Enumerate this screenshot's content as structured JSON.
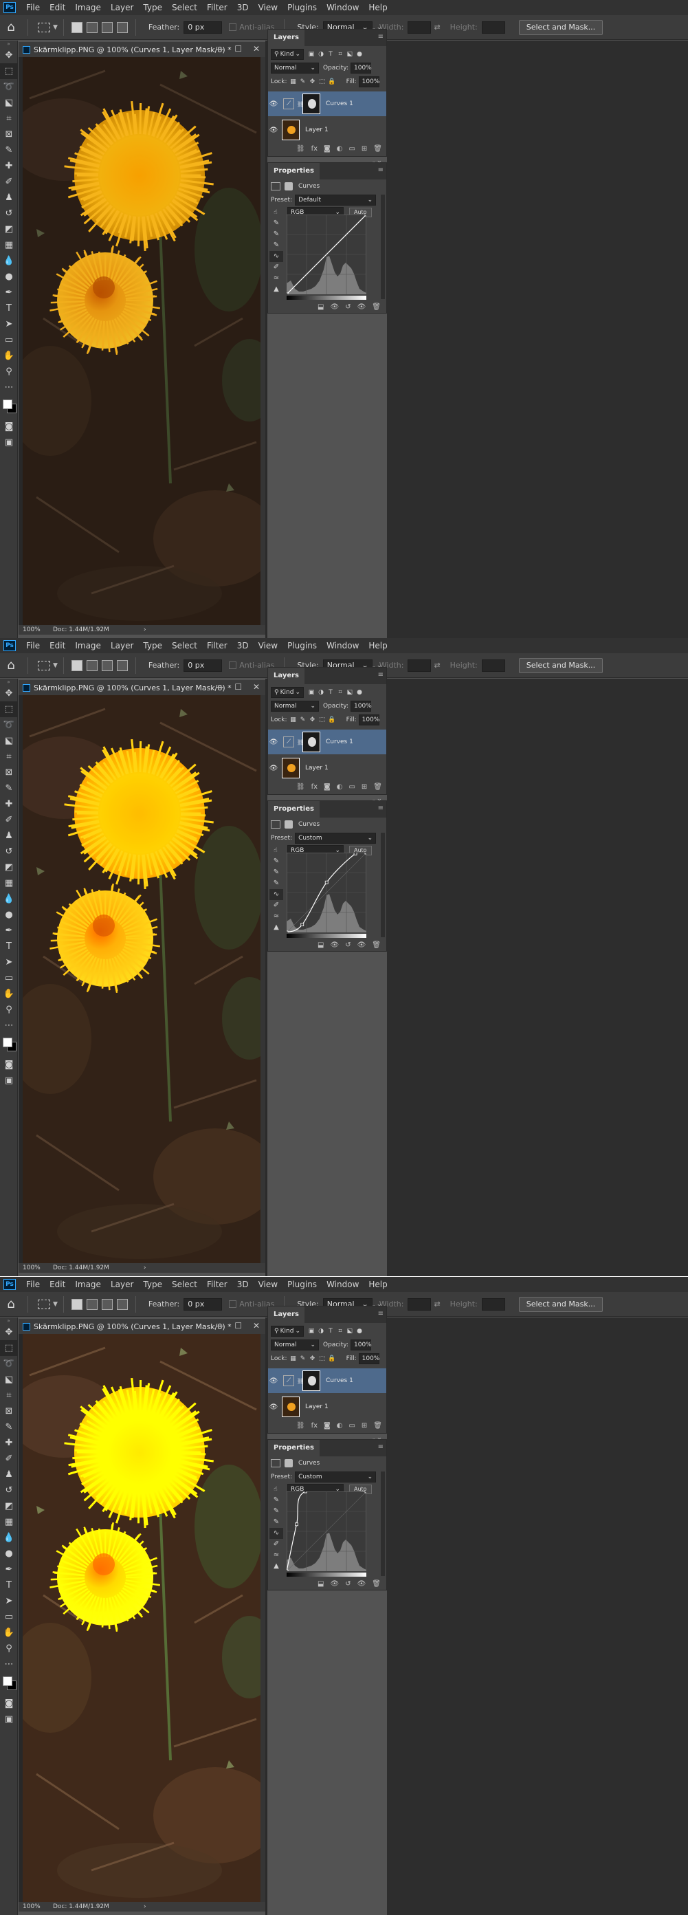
{
  "menu": [
    "File",
    "Edit",
    "Image",
    "Layer",
    "Type",
    "Select",
    "Filter",
    "3D",
    "View",
    "Plugins",
    "Window",
    "Help"
  ],
  "options": {
    "feather_label": "Feather:",
    "feather_value": "0 px",
    "antialias_label": "Anti-alias",
    "style_label": "Style:",
    "style_value": "Normal",
    "width_label": "Width:",
    "height_label": "Height:",
    "select_mask": "Select and Mask..."
  },
  "doc": {
    "title": "Skärmklipp.PNG @ 100% (Curves 1, Layer Mask/8) *",
    "zoom": "100%",
    "info": "Doc: 1.44M/1.92M"
  },
  "layers": {
    "tab": "Layers",
    "kind": "Kind",
    "blend": "Normal",
    "opacity_label": "Opacity:",
    "opacity_value": "100%",
    "lock_label": "Lock:",
    "fill_label": "Fill:",
    "fill_value": "100%",
    "items": [
      {
        "name": "Curves 1",
        "selected": true
      },
      {
        "name": "Layer 1",
        "selected": false
      }
    ]
  },
  "properties": {
    "tab": "Properties",
    "title": "Curves",
    "preset_label": "Preset:",
    "channel": "RGB",
    "auto_label": "Auto"
  },
  "screens": [
    {
      "preset": "Default",
      "brightness": 1.0,
      "curve": [
        [
          0,
          0
        ],
        [
          255,
          255
        ]
      ]
    },
    {
      "preset": "Custom",
      "brightness": 1.18,
      "curve": [
        [
          0,
          0
        ],
        [
          50,
          25
        ],
        [
          128,
          160
        ],
        [
          220,
          252
        ],
        [
          255,
          255
        ]
      ]
    },
    {
      "preset": "Custom",
      "brightness": 1.45,
      "curve": [
        [
          0,
          0
        ],
        [
          32,
          150
        ],
        [
          60,
          255
        ],
        [
          255,
          255
        ]
      ]
    }
  ],
  "colors": {
    "app_bg": "#535353",
    "panel_bg": "#424242",
    "selected_layer": "#4e6a8c",
    "accent": "#31a8ff"
  }
}
